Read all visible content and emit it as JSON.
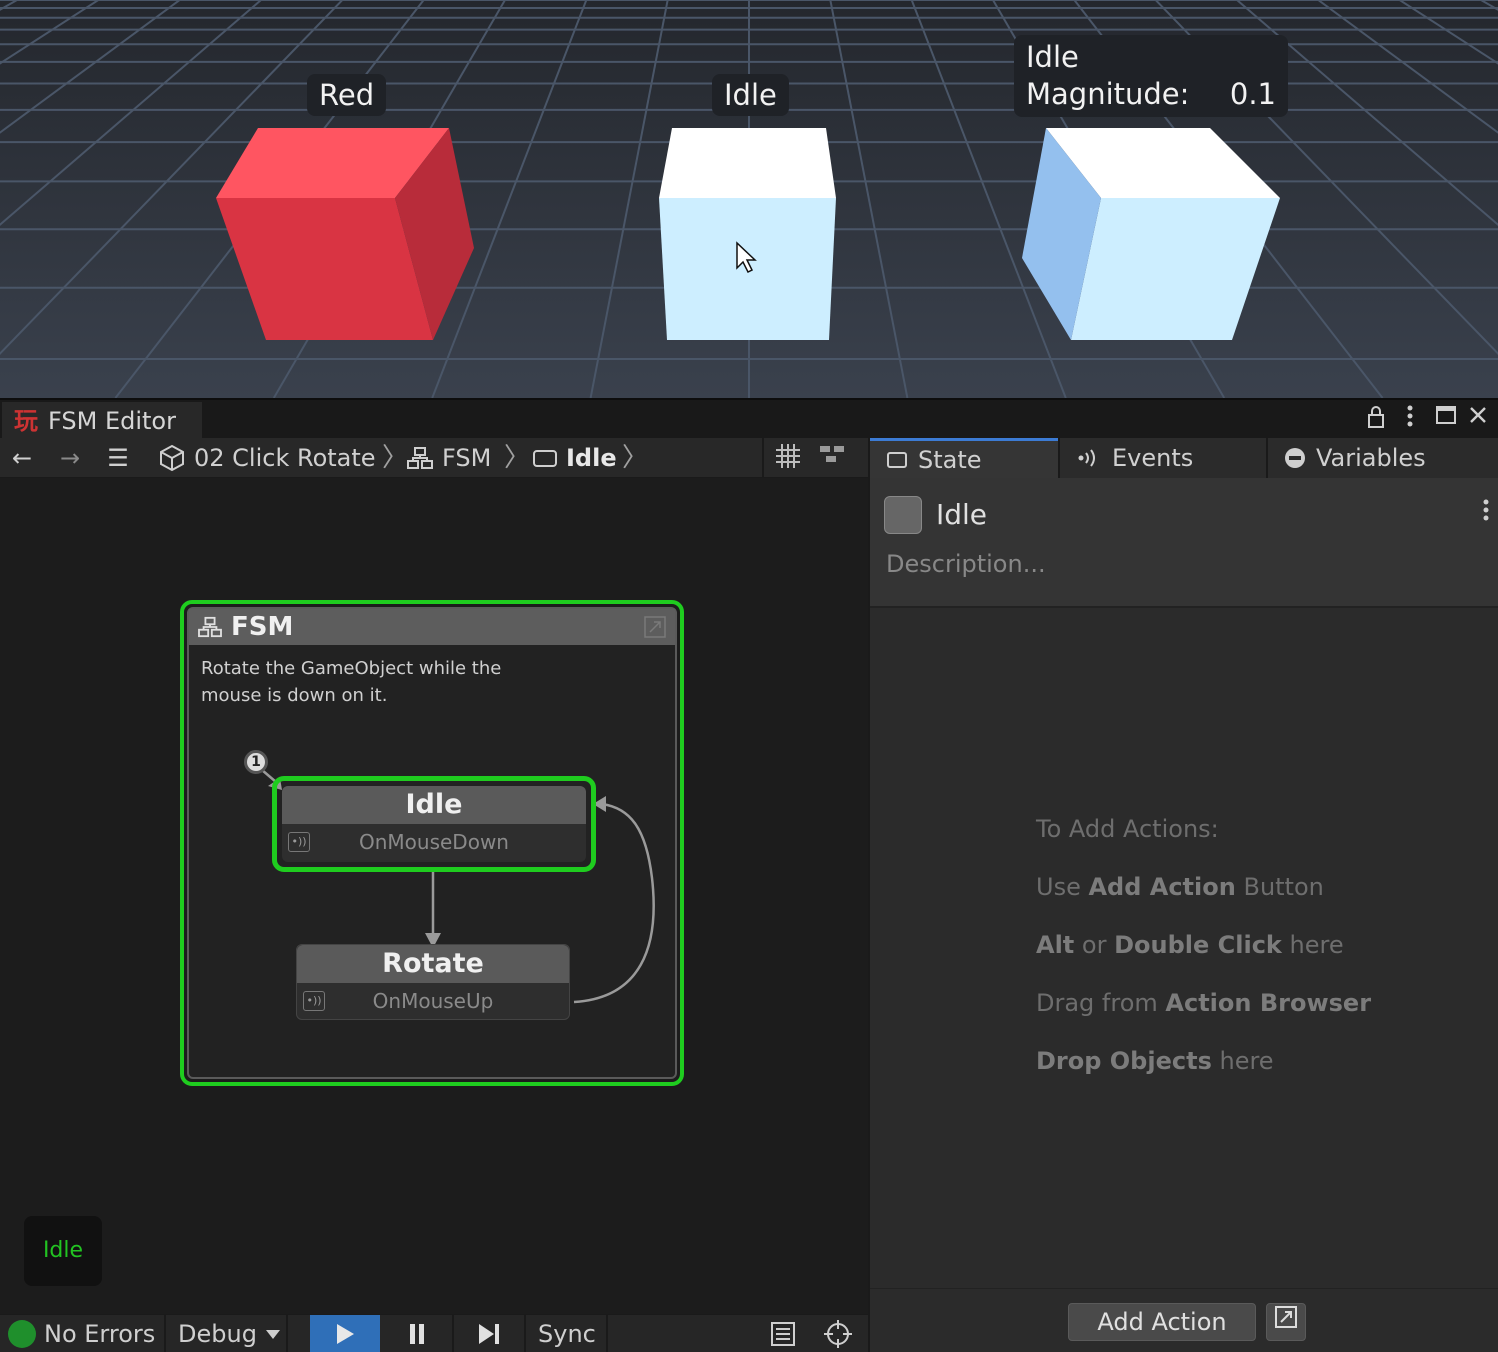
{
  "scene": {
    "labels": [
      "Red",
      "Idle"
    ],
    "tooltip": {
      "state": "Idle",
      "key": "Magnitude:",
      "value": "0.1"
    },
    "colors": {
      "sky": "#2c3038",
      "grid": "#4a5668",
      "red_cube": "#e03a48",
      "white_cube": "#cdeeff"
    }
  },
  "editor": {
    "tab_title": "FSM Editor",
    "logo_glyph": "玩",
    "window_controls": [
      "lock-icon",
      "kebab-icon",
      "maximize-icon",
      "close-icon"
    ]
  },
  "toolbar": {
    "back": "←",
    "forward": "→",
    "menu": "☰",
    "breadcrumbs": [
      "02 Click Rotate",
      "FSM",
      "Idle"
    ],
    "chevron": "〉"
  },
  "graph": {
    "fsm_title": "FSM",
    "fsm_description": "Rotate the GameObject while the mouse is down on it.",
    "start_marker": "1",
    "states": [
      {
        "name": "Idle",
        "event": "OnMouseDown"
      },
      {
        "name": "Rotate",
        "event": "OnMouseUp"
      }
    ],
    "active_state": "Idle",
    "accent": "#1fcc1f"
  },
  "status": {
    "errors": "No Errors",
    "mode": "Debug",
    "sync": "Sync"
  },
  "inspector": {
    "tabs": [
      "State",
      "Events",
      "Variables"
    ],
    "state_name": "Idle",
    "description_placeholder": "Description...",
    "hints": {
      "title": "To Add Actions:",
      "l1a": "Use ",
      "l1b": "Add Action",
      "l1c": " Button",
      "l2a": "Alt",
      "l2b": " or ",
      "l2c": "Double Click",
      "l2d": " here",
      "l3a": "Drag from ",
      "l3b": "Action Browser",
      "l4a": "Drop Objects",
      "l4b": " here"
    },
    "add_action": "Add Action"
  }
}
